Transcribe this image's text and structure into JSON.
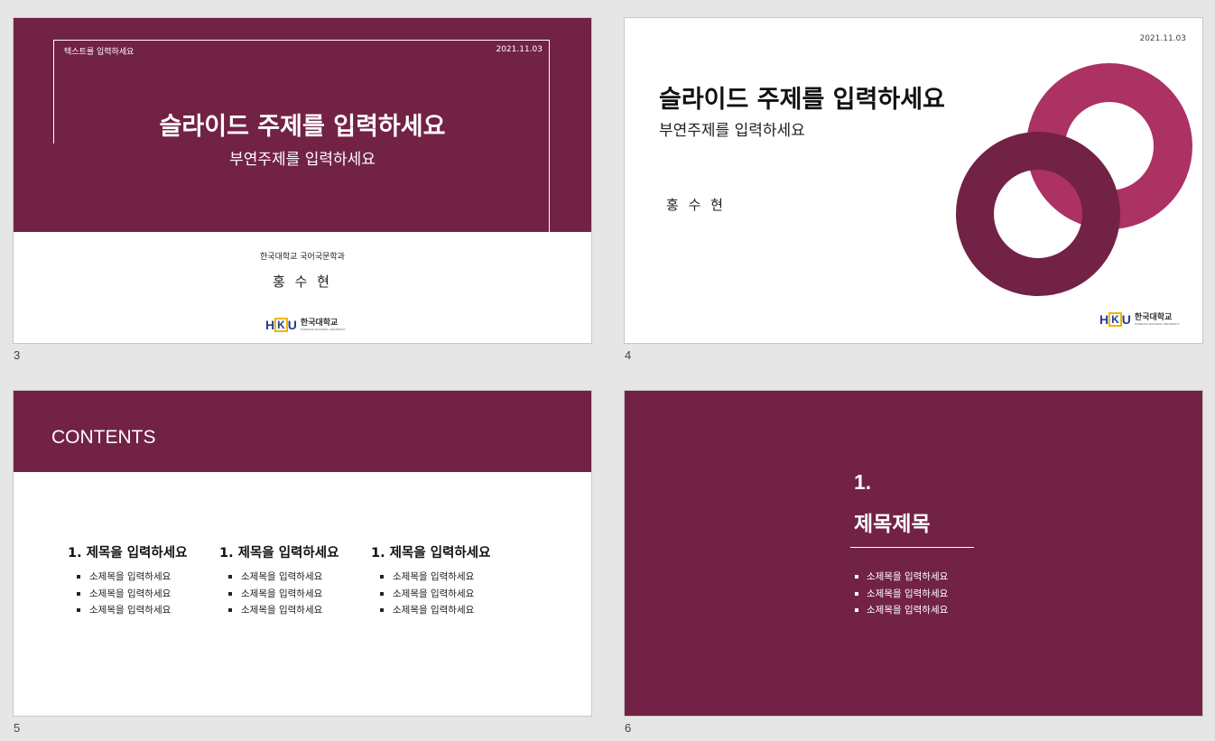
{
  "colors": {
    "background": "#e6e6e6",
    "accent": "#722245",
    "accent_light": "#ab3263",
    "logo_blue": "#1f3f8f",
    "logo_gold": "#f0b400"
  },
  "slides": [
    {
      "number": "3",
      "tag": "텍스트를 입력하세요",
      "date": "2021.11.03",
      "title": "슬라이드 주제를 입력하세요",
      "subtitle": "부연주제를 입력하세요",
      "department": "한국대학교 국어국문학과",
      "presenter": "홍 수 현",
      "logo": {
        "mark": "HKU",
        "name": "한국대학교",
        "english": "HANKOOK NATIONAL UNIVERSITY"
      }
    },
    {
      "number": "4",
      "date": "2021.11.03",
      "title": "슬라이드 주제를 입력하세요",
      "subtitle": "부연주제를 입력하세요",
      "presenter": "홍 수 현",
      "logo": {
        "mark": "HKU",
        "name": "한국대학교",
        "english": "HANKOOK NATIONAL UNIVERSITY"
      }
    },
    {
      "number": "5",
      "heading": "CONTENTS",
      "columns": [
        {
          "title": "1.  제목을 입력하세요",
          "items": [
            "소제목을 입력하세요",
            "소제목을 입력하세요",
            "소제목을 입력하세요"
          ]
        },
        {
          "title": "1.  제목을 입력하세요",
          "items": [
            "소제목을 입력하세요",
            "소제목을 입력하세요",
            "소제목을 입력하세요"
          ]
        },
        {
          "title": "1.  제목을 입력하세요",
          "items": [
            "소제목을 입력하세요",
            "소제목을 입력하세요",
            "소제목을 입력하세요"
          ]
        }
      ]
    },
    {
      "number": "6",
      "section_number": "1.",
      "section_title": "제목제목",
      "items": [
        "소제목을 입력하세요",
        "소제목을 입력하세요",
        "소제목을 입력하세요"
      ]
    }
  ]
}
